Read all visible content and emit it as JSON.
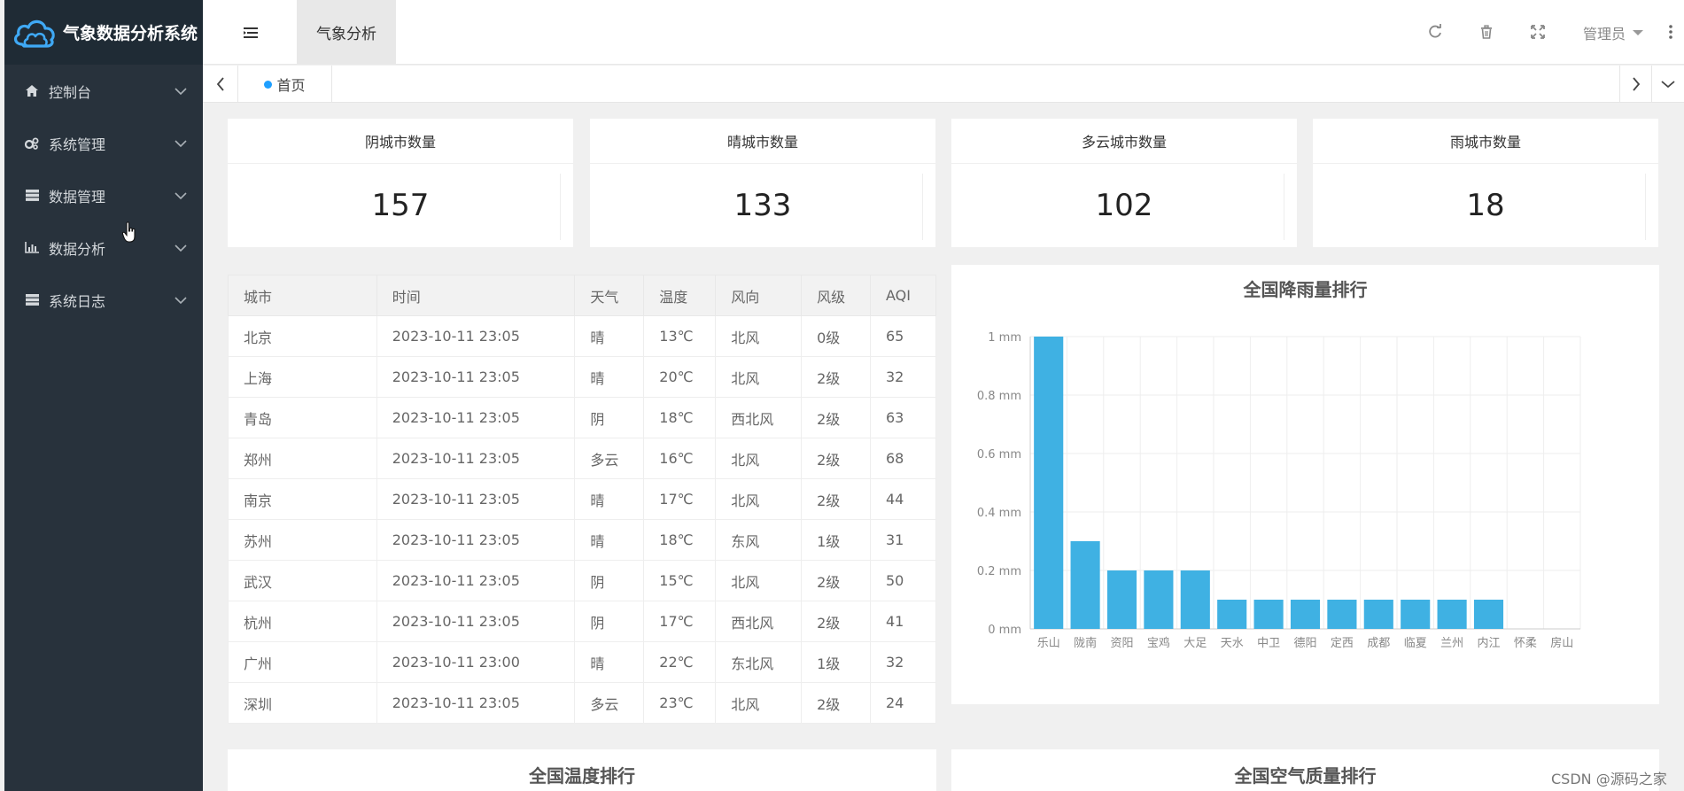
{
  "app": {
    "title": "气象数据分析系统"
  },
  "sidebar": {
    "items": [
      {
        "label": "控制台",
        "icon": "home-icon"
      },
      {
        "label": "系统管理",
        "icon": "gears-icon"
      },
      {
        "label": "数据管理",
        "icon": "server-icon"
      },
      {
        "label": "数据分析",
        "icon": "bar-chart-icon"
      },
      {
        "label": "系统日志",
        "icon": "server-icon"
      }
    ]
  },
  "header": {
    "active_tab": "气象分析",
    "user": "管理员"
  },
  "tabs": {
    "home": "首页"
  },
  "stats": [
    {
      "label": "阴城市数量",
      "value": "157"
    },
    {
      "label": "晴城市数量",
      "value": "133"
    },
    {
      "label": "多云城市数量",
      "value": "102"
    },
    {
      "label": "雨城市数量",
      "value": "18"
    }
  ],
  "table": {
    "columns": [
      "城市",
      "时间",
      "天气",
      "温度",
      "风向",
      "风级",
      "AQI"
    ],
    "rows": [
      [
        "北京",
        "2023-10-11 23:05",
        "晴",
        "13℃",
        "北风",
        "0级",
        "65"
      ],
      [
        "上海",
        "2023-10-11 23:05",
        "晴",
        "20℃",
        "北风",
        "2级",
        "32"
      ],
      [
        "青岛",
        "2023-10-11 23:05",
        "阴",
        "18℃",
        "西北风",
        "2级",
        "63"
      ],
      [
        "郑州",
        "2023-10-11 23:05",
        "多云",
        "16℃",
        "北风",
        "2级",
        "68"
      ],
      [
        "南京",
        "2023-10-11 23:05",
        "晴",
        "17℃",
        "北风",
        "2级",
        "44"
      ],
      [
        "苏州",
        "2023-10-11 23:05",
        "晴",
        "18℃",
        "东风",
        "1级",
        "31"
      ],
      [
        "武汉",
        "2023-10-11 23:05",
        "阴",
        "15℃",
        "北风",
        "2级",
        "50"
      ],
      [
        "杭州",
        "2023-10-11 23:05",
        "阴",
        "17℃",
        "西北风",
        "2级",
        "41"
      ],
      [
        "广州",
        "2023-10-11 23:00",
        "晴",
        "22℃",
        "东北风",
        "1级",
        "32"
      ],
      [
        "深圳",
        "2023-10-11 23:05",
        "多云",
        "23℃",
        "北风",
        "2级",
        "24"
      ]
    ]
  },
  "chart_data": {
    "type": "bar",
    "title": "全国降雨量排行",
    "categories": [
      "乐山",
      "陇南",
      "资阳",
      "宝鸡",
      "大足",
      "天水",
      "中卫",
      "德阳",
      "定西",
      "成都",
      "临夏",
      "兰州",
      "内江",
      "怀柔",
      "房山"
    ],
    "values": [
      1,
      0.3,
      0.2,
      0.2,
      0.2,
      0.1,
      0.1,
      0.1,
      0.1,
      0.1,
      0.1,
      0.1,
      0.1,
      0,
      0
    ],
    "ylim": [
      0,
      1
    ],
    "yticks": [
      "0 mm",
      "0.2 mm",
      "0.4 mm",
      "0.6 mm",
      "0.8 mm",
      "1 mm"
    ],
    "grid": true,
    "color": "#3fb1e3"
  },
  "bottom": {
    "left_title": "全国温度排行",
    "right_title": "全国空气质量排行"
  },
  "watermark": "CSDN @源码之家"
}
